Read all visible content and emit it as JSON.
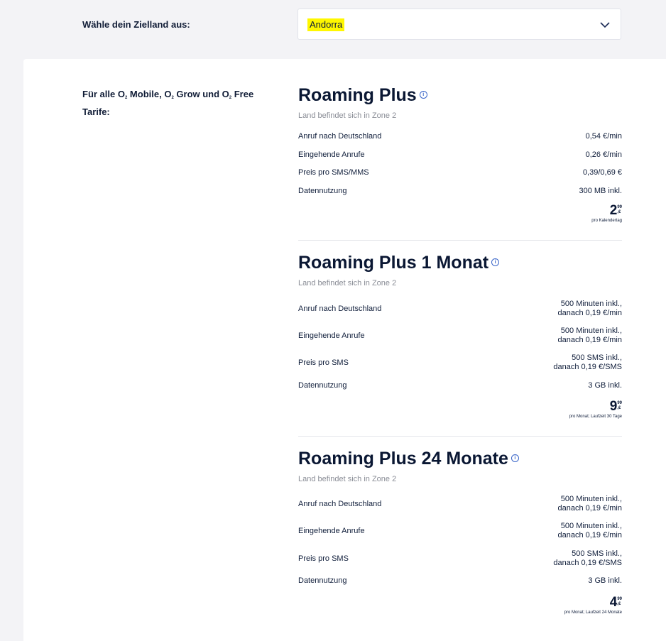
{
  "header": {
    "label": "Wähle dein Zielland aus:",
    "select_value": "Andorra"
  },
  "intro": {
    "parts": [
      "Für alle O",
      "2",
      " Mobile, O",
      "2",
      " Grow und O",
      "2",
      " Free Tarife:"
    ]
  },
  "sections": [
    {
      "title": "Roaming Plus",
      "info": "i",
      "zone": "Land befindet sich in Zone 2",
      "rows": [
        {
          "label": "Anruf nach Deutschland",
          "value": "0,54 €/min"
        },
        {
          "label": "Eingehende Anrufe",
          "value": "0,26 €/min"
        },
        {
          "label": "Preis pro SMS/MMS",
          "value": "0,39/0,69 €"
        },
        {
          "label": "Datennutzung",
          "value": "300 MB inkl."
        }
      ],
      "price": {
        "euros": "2",
        "cents": "99",
        "currency": ",€",
        "note": "pro Kalendertag"
      }
    },
    {
      "title": "Roaming Plus 1 Monat",
      "info": "i",
      "zone": "Land befindet sich in Zone 2",
      "rows": [
        {
          "label": "Anruf nach Deutschland",
          "value_line1": "500 Minuten inkl.,",
          "value_line2": "danach 0,19 €/min"
        },
        {
          "label": "Eingehende Anrufe",
          "value_line1": "500 Minuten inkl.,",
          "value_line2": "danach 0,19 €/min"
        },
        {
          "label": "Preis pro SMS",
          "value_line1": "500 SMS inkl.,",
          "value_line2": "danach 0,19 €/SMS"
        },
        {
          "label": "Datennutzung",
          "value": "3 GB inkl."
        }
      ],
      "price": {
        "euros": "9",
        "cents": "99",
        "currency": ",€",
        "note": "pro Monat; Laufzeit 30 Tage"
      }
    },
    {
      "title": "Roaming Plus 24 Monate",
      "info": "i",
      "zone": "Land befindet sich in Zone 2",
      "rows": [
        {
          "label": "Anruf nach Deutschland",
          "value_line1": "500 Minuten inkl.,",
          "value_line2": "danach 0,19 €/min"
        },
        {
          "label": "Eingehende Anrufe",
          "value_line1": "500 Minuten inkl.,",
          "value_line2": "danach 0,19 €/min"
        },
        {
          "label": "Preis pro SMS",
          "value_line1": "500 SMS inkl.,",
          "value_line2": "danach 0,19 €/SMS"
        },
        {
          "label": "Datennutzung",
          "value": "3 GB inkl."
        }
      ],
      "price": {
        "euros": "4",
        "cents": "99",
        "currency": ",€",
        "note": "pro Monat; Laufzeit 24 Monate"
      }
    }
  ],
  "colors": {
    "highlight": "#fff700",
    "accent": "#3a66c9",
    "text": "#0f1d3a"
  },
  "icons": {
    "select": "chevron-down-icon",
    "info": "info-icon"
  }
}
